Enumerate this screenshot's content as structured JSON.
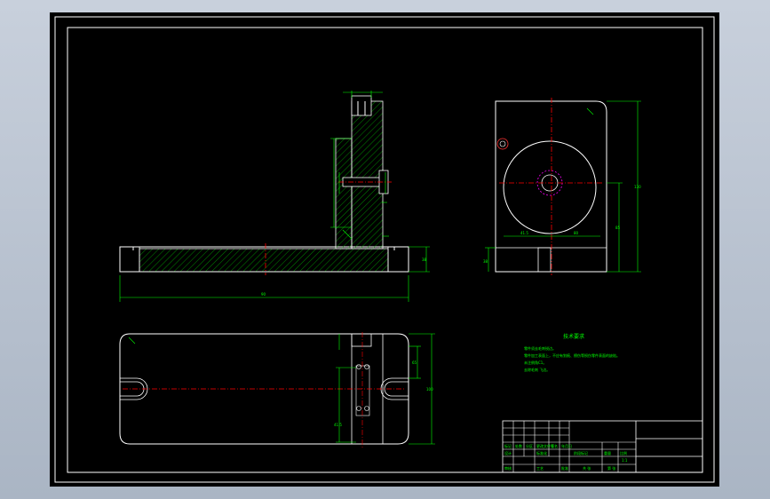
{
  "drawing": {
    "colors": {
      "background": "#000000",
      "outline": "#ffffff",
      "dimension": "#00ff00",
      "centerline": "#ff0000",
      "hatch": "#00aa00",
      "hidden": "#ff00ff"
    },
    "labels": {
      "overall_length": "90",
      "base_height": "38",
      "side_height": "130",
      "side_base": "38",
      "side_width_a": "41.5",
      "side_width_b": "80",
      "right_dim": "85",
      "plan_width": "100",
      "plan_inner": "65",
      "plan_left": "41.5"
    },
    "tech_title": "技术要求",
    "tech_notes": [
      "零件须去毛刺锐边。",
      "零件加工表面上，不应有划痕、擦伤等损伤零件表面的缺陷。",
      "未注倒角C1。",
      "去除毛刺 飞边。"
    ],
    "title_block": {
      "row1": [
        "标记",
        "处数",
        "分区",
        "更改文件号",
        "签名",
        "年月日"
      ],
      "row2": [
        "设计",
        "标准化",
        "阶段标记",
        "重量",
        "比例"
      ],
      "row3": [
        "审核",
        "工艺",
        "批准",
        "共 张",
        "第 张"
      ],
      "scale": "1:1"
    }
  }
}
